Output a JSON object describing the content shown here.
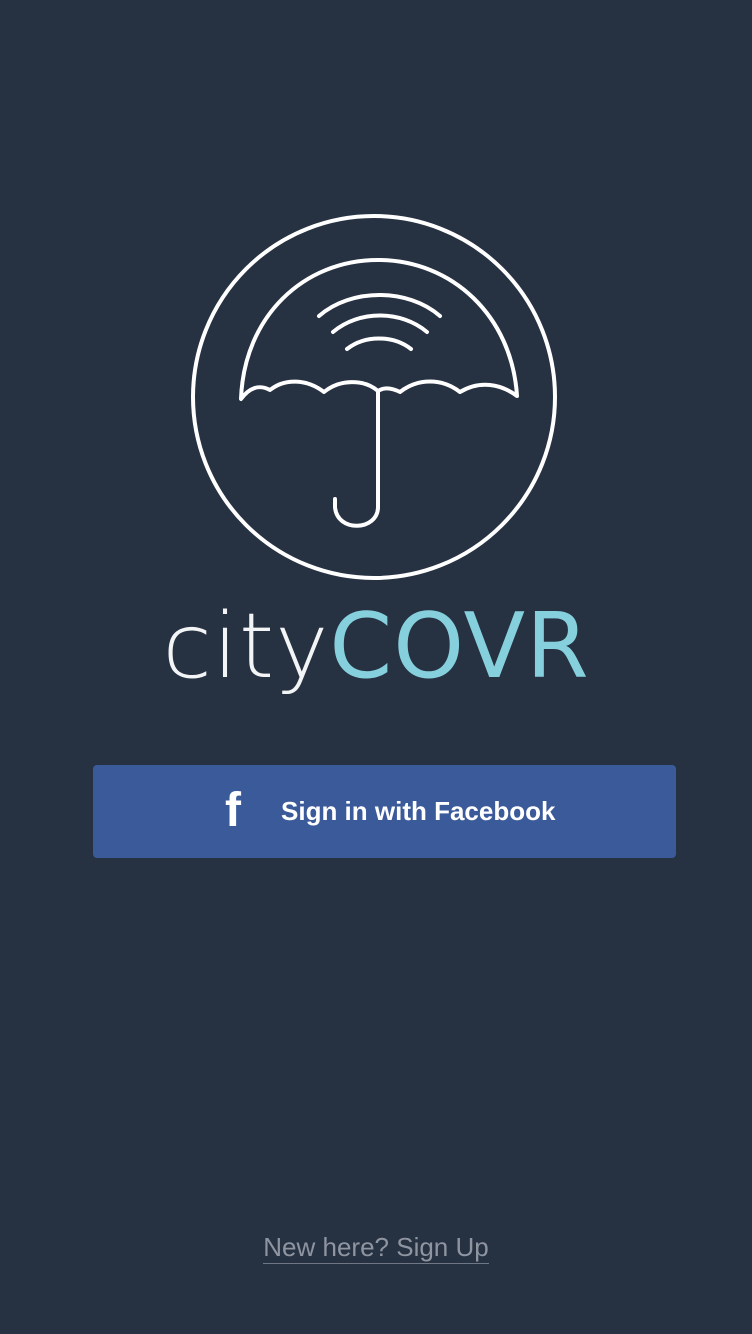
{
  "app": {
    "brand_part1": "city",
    "brand_part2": "COVR",
    "logo_icon": "umbrella-wifi-icon"
  },
  "login": {
    "facebook_label": "Sign in with Facebook",
    "facebook_icon": "facebook-icon",
    "facebook_glyph": "f"
  },
  "footer": {
    "signup_text": "New here? Sign Up"
  },
  "colors": {
    "background": "#263142",
    "accent": "#86d0dd",
    "facebook_blue": "#3b5a9a",
    "logo_stroke": "#ffffff",
    "muted_text": "#8e95a1"
  }
}
